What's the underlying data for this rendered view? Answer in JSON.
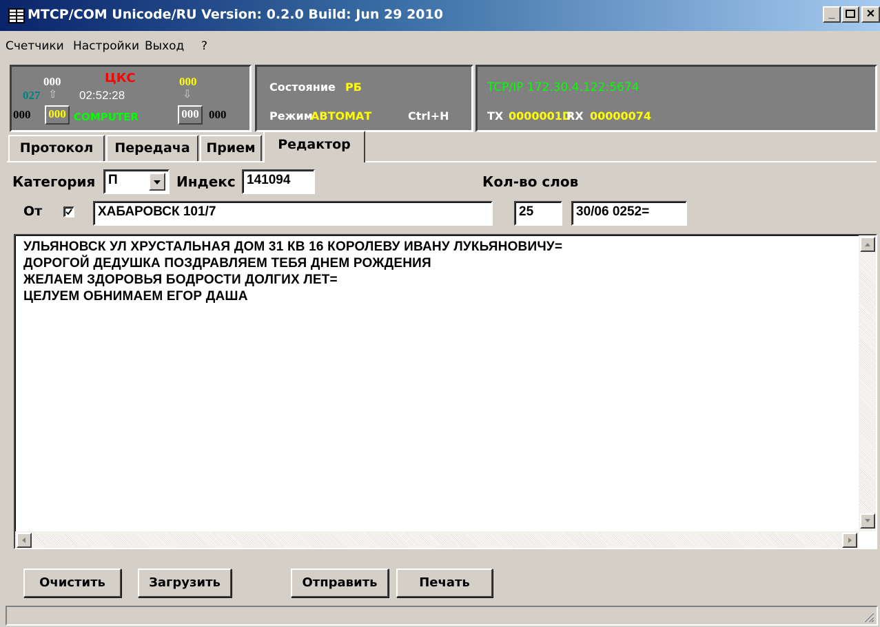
{
  "window": {
    "title": "МТСР/COM  Unicode/RU  Version: 0.2.0  Build: Jun 29 2010"
  },
  "menu": [
    "Счетчики",
    "Настройки",
    "Выход",
    "?"
  ],
  "status": {
    "counter_top_left": "000",
    "counter_cyan": "027",
    "station": "ЦКС",
    "time": "02:52:28",
    "counter_top_right": "000",
    "counter_bottom_left": "000",
    "box_left": "000",
    "computer": "COMPUTER",
    "box_right": "000",
    "counter_bottom_right": "000",
    "state_label": "Состояние",
    "state_value": "РБ",
    "mode_label": "Режим",
    "mode_value": "АВТОМАТ",
    "hotkey": "Ctrl+H",
    "connection": "TCP/IP 172.30.4.122:5674",
    "tx_label": "TX",
    "tx_value": "0000001D",
    "rx_label": "RX",
    "rx_value": "00000074"
  },
  "tabs": [
    "Протокол",
    "Передача",
    "Прием",
    "Редактор"
  ],
  "active_tab": "Редактор",
  "editor": {
    "category_label": "Категория",
    "category_value": "П",
    "index_label": "Индекс",
    "index_value": "141094",
    "words_label": "Кол-во слов",
    "from_label": "От",
    "from_checked": true,
    "from_value": "ХАБАРОВСК 101/7",
    "words_value": "25",
    "date_value": "30/06 0252=",
    "body": [
      "УЛЬЯНОВСК УЛ ХРУСТАЛЬНАЯ ДОМ 31 КВ 16 КОРОЛЕВУ ИВАНУ ЛУКЬЯНОВИЧУ=",
      "ДОРОГОЙ ДЕДУШКА ПОЗДРАВЛЯЕМ ТЕБЯ ДНЕМ РОЖДЕНИЯ",
      "ЖЕЛАЕМ ЗДОРОВЬЯ БОДРОСТИ ДОЛГИХ ЛЕТ=",
      "ЦЕЛУЕМ ОБНИМАЕМ ЕГОР ДАША"
    ]
  },
  "buttons": {
    "clear": "Очистить",
    "load": "Загрузить",
    "send": "Отправить",
    "print": "Печать"
  },
  "colors": {
    "red": "#ff0000",
    "yellow": "#ffff00",
    "green": "#00ff00",
    "cyan": "#008080"
  }
}
